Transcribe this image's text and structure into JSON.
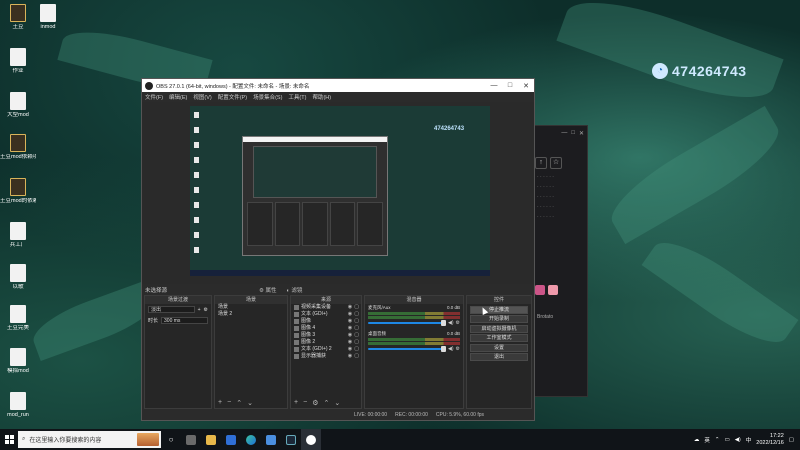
{
  "desktop_icons": [
    {
      "label": "土豆",
      "kind": "dark"
    },
    {
      "label": "inmod",
      "kind": "doc"
    },
    {
      "label": "作业",
      "kind": "doc"
    },
    {
      "label": "大型mod",
      "kind": "doc"
    },
    {
      "label": "土豆mod依赖项",
      "kind": "dark"
    },
    {
      "label": "土豆mod的依赖项",
      "kind": "dark"
    },
    {
      "label": "兵工厂",
      "kind": "doc"
    },
    {
      "label": "以歌",
      "kind": "doc"
    },
    {
      "label": "土豆完美",
      "kind": "doc"
    },
    {
      "label": "模拟mod",
      "kind": "doc"
    },
    {
      "label": "mod_run",
      "kind": "doc"
    }
  ],
  "watermark": "474264743",
  "chat_window": {
    "buttons": [
      "↑",
      "☆"
    ],
    "user_label": "Brotato"
  },
  "obs": {
    "title": "OBS 27.0.1 (64-bit, windows) - 配置文件: 未命名 - 场景: 未命名",
    "menu": [
      "文件(F)",
      "编辑(E)",
      "视图(V)",
      "配置文件(P)",
      "场景集合(S)",
      "工具(T)",
      "帮助(H)"
    ],
    "preview_watermark": "474264743",
    "scene_label": "未选择源",
    "toolbar": [
      "属性",
      "滤镜"
    ],
    "docks": {
      "scene_filters": {
        "title": "场景过渡",
        "transition": "淡出",
        "duration_label": "时长",
        "duration": "300 ms"
      },
      "scenes": {
        "title": "场景",
        "items": [
          "场景",
          "场景 2"
        ]
      },
      "sources": {
        "title": "来源",
        "items": [
          "视频采集设备",
          "文本 (GDI+)",
          "图像",
          "图像 4",
          "图像 3",
          "图像 2",
          "文本 (GDI+) 2",
          "显示器捕获"
        ]
      },
      "mixer": {
        "title": "混音器",
        "channels": [
          {
            "name": "麦克风/Aux",
            "level": "0.0 dB"
          },
          {
            "name": "桌面音频",
            "level": "0.0 dB"
          }
        ]
      },
      "controls": {
        "title": "控件",
        "buttons": [
          "停止推流",
          "开始录制",
          "启动虚拟摄像机",
          "工作室模式",
          "设置",
          "退出"
        ]
      }
    },
    "status": {
      "live": "LIVE: 00:00:00",
      "rec": "REC: 00:00:00",
      "cpu": "CPU: 5.9%, 60.00 fps"
    }
  },
  "taskbar": {
    "search_placeholder": "在这里输入你要搜索的内容",
    "tray_label": "英",
    "time": "17:22",
    "date": "2022/12/16"
  }
}
